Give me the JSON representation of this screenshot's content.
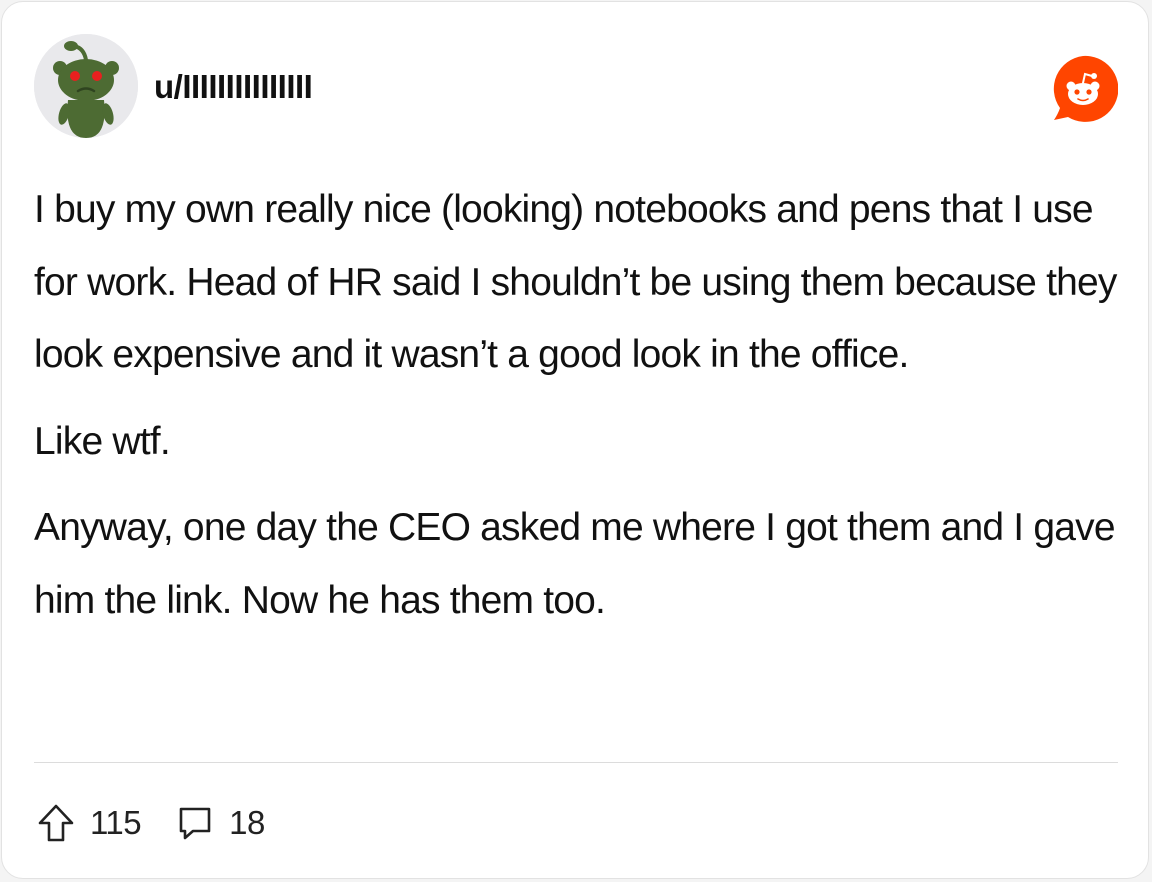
{
  "post": {
    "author": "u/IIIIIIIIIIIIIII",
    "paragraphs": [
      "I buy my own really nice (looking) notebooks and pens that I use for work. Head of HR said I shouldn’t be using them because they look expensive and it wasn’t a good look in the office.",
      "Like wtf.",
      "Anyway, one day the CEO asked me where I got them and I gave him the link. Now he has them too."
    ],
    "upvotes": "115",
    "comments": "18"
  },
  "icons": {
    "avatar": "snoo-avatar-icon",
    "logo": "reddit-logo-icon",
    "upvote": "upvote-arrow-icon",
    "comment": "comment-bubble-icon"
  },
  "colors": {
    "reddit_orange": "#ff4500",
    "avatar_green": "#4d6b33",
    "avatar_eyes": "#e8201f",
    "avatar_bg": "#e9e9ec"
  }
}
